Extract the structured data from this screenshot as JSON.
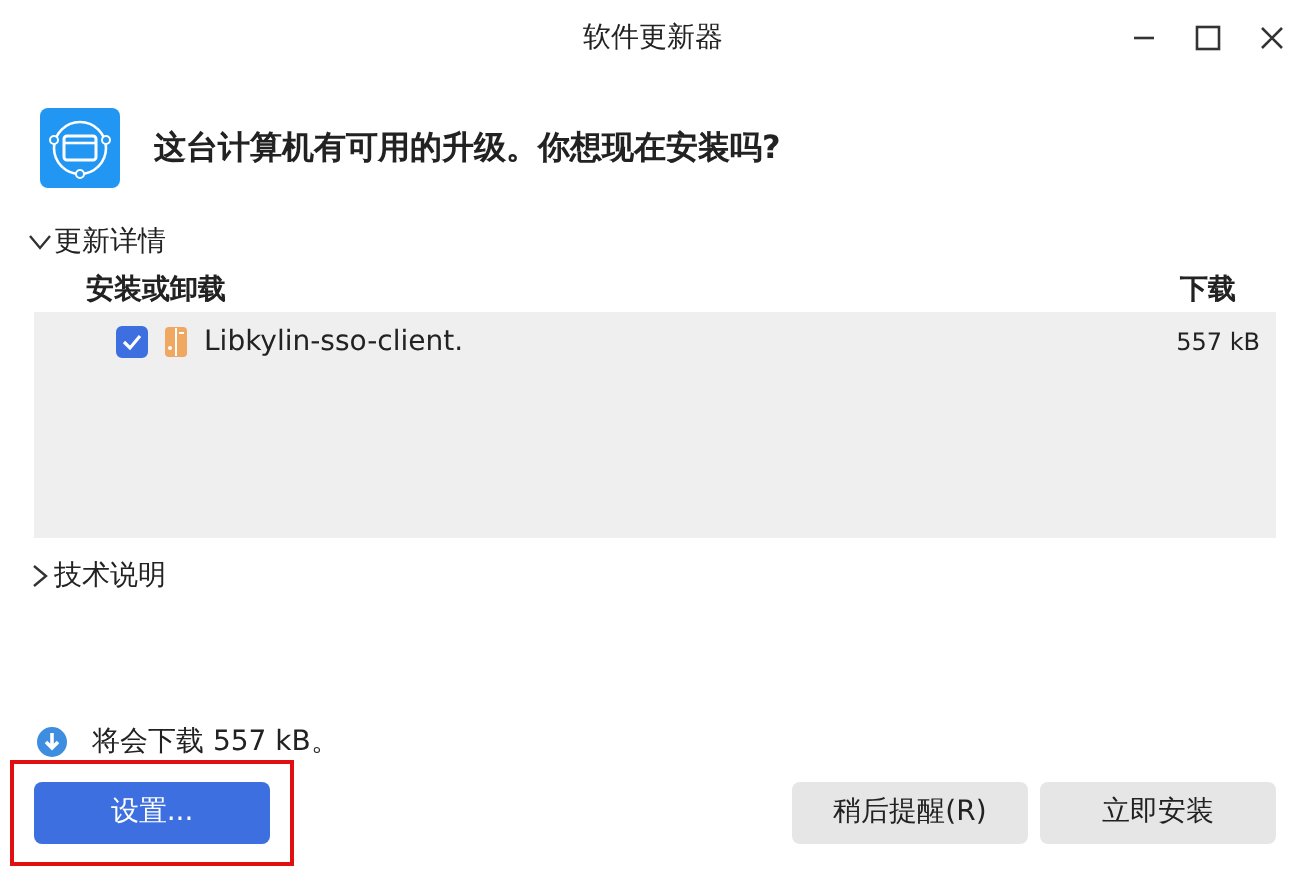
{
  "window": {
    "title": "软件更新器"
  },
  "heading": "这台计算机有可用的升级。你想现在安装吗?",
  "details": {
    "label": "更新详情",
    "expanded": true,
    "columns": [
      "安装或卸载",
      "下载"
    ],
    "rows": [
      {
        "name": "Libkylin-sso-client.",
        "size": "557 kB",
        "checked": true
      }
    ]
  },
  "tech_notes": {
    "label": "技术说明",
    "expanded": false
  },
  "download_info": "将会下载 557 kB。",
  "buttons": [
    {
      "label": "设置...",
      "kind": "primary",
      "highlighted": true
    },
    {
      "label": "稍后提醒(R)",
      "kind": "secondary",
      "highlighted": false
    },
    {
      "label": "立即安装",
      "kind": "secondary",
      "highlighted": false
    }
  ]
}
